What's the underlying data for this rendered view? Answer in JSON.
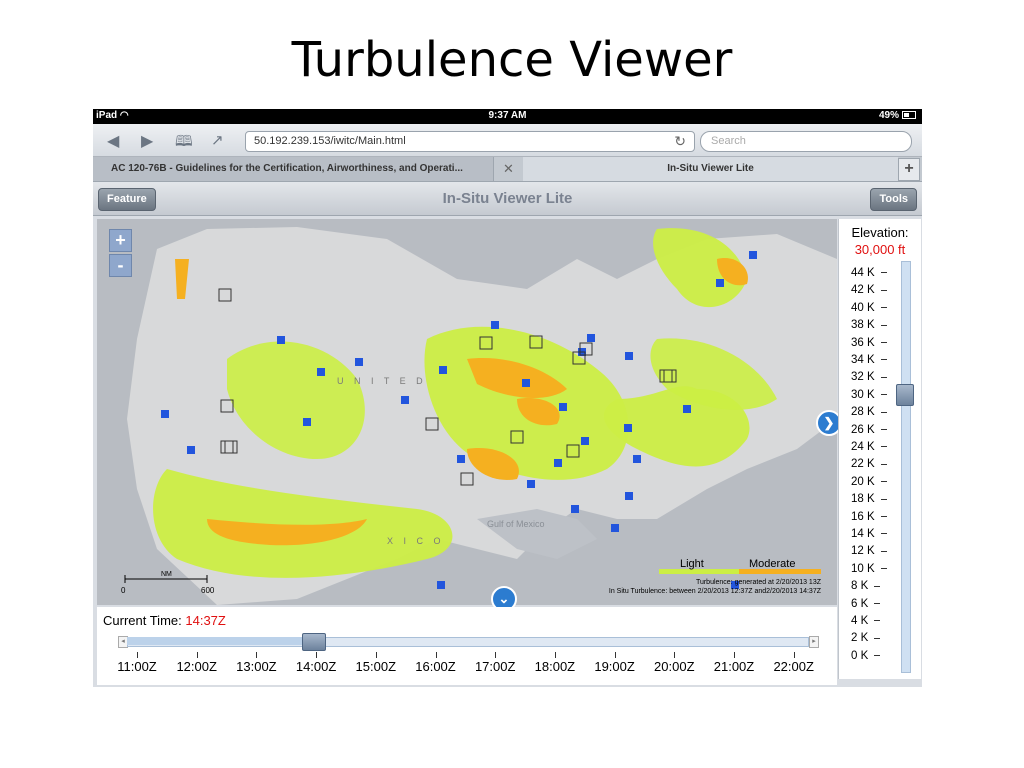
{
  "slide": {
    "title": "Turbulence Viewer"
  },
  "status_bar": {
    "device": "iPad",
    "time": "9:37 AM",
    "battery": "49%"
  },
  "browser": {
    "url": "50.192.239.153/iwitc/Main.html",
    "search_placeholder": "Search",
    "tabs": [
      {
        "label": "AC 120-76B - Guidelines for the Certification, Airworthiness, and Operati..."
      },
      {
        "label": "In-Situ Viewer Lite"
      }
    ]
  },
  "app": {
    "title": "In-Situ Viewer Lite",
    "feature_button": "Feature",
    "tools_button": "Tools"
  },
  "map": {
    "labels": {
      "country": "U N I T E D",
      "mexico": "X I C O",
      "gulf": "Gulf of Mexico"
    },
    "scale": {
      "unit": "NM",
      "start": "0",
      "end": "600"
    },
    "legend": {
      "light": "Light",
      "moderate": "Moderate",
      "light_color": "#ccee44",
      "moderate_color": "#f5b020",
      "generated": "Turbulence: generated at 2/20/2013 13Z",
      "between": "In Situ Turbulence: between 2/20/2013 12:37Z and2/20/2013 14:37Z"
    },
    "zoom_in": "+",
    "zoom_out": "-"
  },
  "elevation": {
    "label": "Elevation:",
    "value": "30,000 ft",
    "ticks": [
      "44 K",
      "42 K",
      "40 K",
      "38 K",
      "36 K",
      "34 K",
      "32 K",
      "30 K",
      "28 K",
      "26 K",
      "24 K",
      "22 K",
      "20 K",
      "18 K",
      "16 K",
      "14 K",
      "12 K",
      "10 K",
      "8 K",
      "6 K",
      "4 K",
      "2 K",
      "0 K"
    ]
  },
  "time": {
    "label": "Current Time:",
    "value": "14:37Z",
    "ticks": [
      "11:00Z",
      "12:00Z",
      "13:00Z",
      "14:00Z",
      "15:00Z",
      "16:00Z",
      "17:00Z",
      "18:00Z",
      "19:00Z",
      "20:00Z",
      "21:00Z",
      "22:00Z"
    ]
  }
}
